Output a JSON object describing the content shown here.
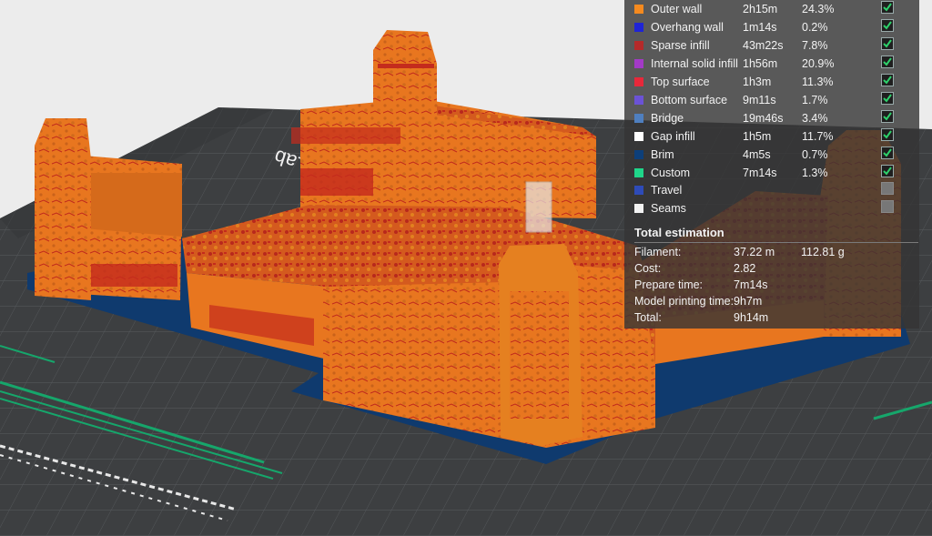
{
  "viewport": {
    "plate_label": "Lab",
    "colors": {
      "background": "#ececec",
      "plate": "#3d3f41",
      "grid_line": "#55585b",
      "model": "#e8761f",
      "model_shadow": "#b95a12",
      "brim": "#0f3a6e",
      "infill_accent": "#c22a1c",
      "plate_stripe": "#16a66b"
    }
  },
  "legend": {
    "features": [
      {
        "name": "Outer wall",
        "time": "2h15m",
        "percent": "24.3%",
        "color": "#f58a1f",
        "checked": true
      },
      {
        "name": "Overhang wall",
        "time": "1m14s",
        "percent": "0.2%",
        "color": "#1f24d6",
        "checked": true
      },
      {
        "name": "Sparse infill",
        "time": "43m22s",
        "percent": "7.8%",
        "color": "#b52a2a",
        "checked": true
      },
      {
        "name": "Internal solid infill",
        "time": "1h56m",
        "percent": "20.9%",
        "color": "#a33ac7",
        "checked": true
      },
      {
        "name": "Top surface",
        "time": "1h3m",
        "percent": "11.3%",
        "color": "#e8283a",
        "checked": true
      },
      {
        "name": "Bottom surface",
        "time": "9m11s",
        "percent": "1.7%",
        "color": "#6b52d6",
        "checked": true
      },
      {
        "name": "Bridge",
        "time": "19m46s",
        "percent": "3.4%",
        "color": "#4f7fbf",
        "checked": true
      },
      {
        "name": "Gap infill",
        "time": "1h5m",
        "percent": "11.7%",
        "color": "#ffffff",
        "checked": true
      },
      {
        "name": "Brim",
        "time": "4m5s",
        "percent": "0.7%",
        "color": "#0d3f7a",
        "checked": true
      },
      {
        "name": "Custom",
        "time": "7m14s",
        "percent": "1.3%",
        "color": "#1fd68a",
        "checked": true
      },
      {
        "name": "Travel",
        "time": "",
        "percent": "",
        "color": "#2e4bb8",
        "checked": false
      },
      {
        "name": "Seams",
        "time": "",
        "percent": "",
        "color": "#f2f2f2",
        "checked": false
      }
    ],
    "check_color": "#2ed16b"
  },
  "total": {
    "title": "Total estimation",
    "filament_label": "Filament:",
    "filament_length": "37.22 m",
    "filament_weight": "112.81 g",
    "cost_label": "Cost:",
    "cost": "2.82",
    "prepare_label": "Prepare time:",
    "prepare": "7m14s",
    "model_time_label": "Model printing time:",
    "model_time": "9h7m",
    "total_label": "Total:",
    "total_time": "9h14m"
  }
}
